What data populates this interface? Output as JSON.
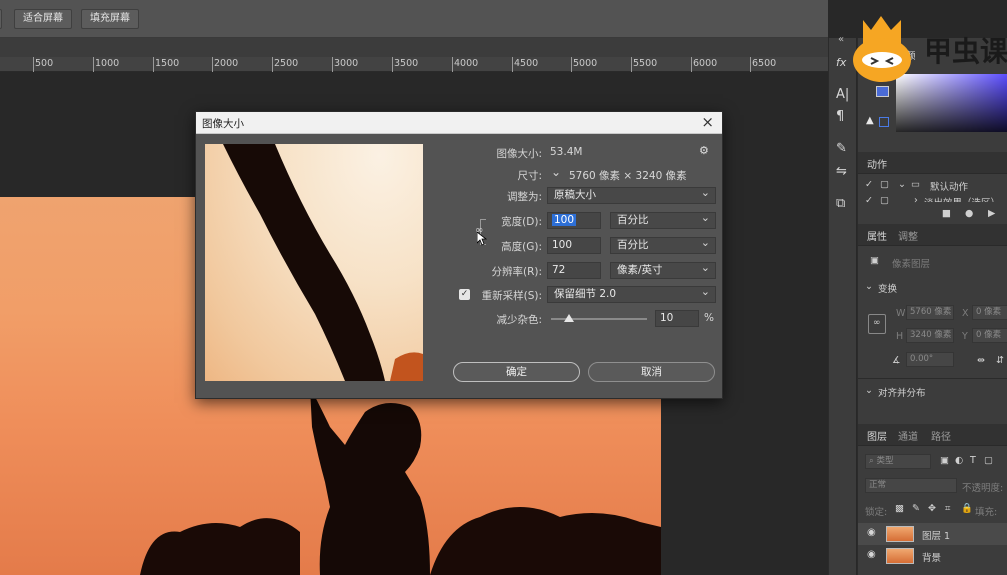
{
  "options_bar": {
    "fit_screen": "适合屏幕",
    "fill_screen": "填充屏幕"
  },
  "ruler": {
    "labels": [
      "500",
      "1000",
      "1500",
      "2000",
      "2500",
      "3000",
      "3500",
      "4000",
      "4500",
      "5000",
      "5500",
      "6000",
      "6500"
    ]
  },
  "dialog": {
    "title": "图像大小",
    "close_icon": "close-icon",
    "image_size_label": "图像大小:",
    "image_size_value": "53.4M",
    "settings_icon": "gear-icon",
    "dimensions_label": "尺寸:",
    "dimensions_value": "5760 像素  ×  3240 像素",
    "fit_to_label": "调整为:",
    "fit_to_value": "原稿大小",
    "width_label": "宽度(D):",
    "width_value": "100",
    "width_unit": "百分比",
    "height_label": "高度(G):",
    "height_value": "100",
    "height_unit": "百分比",
    "resolution_label": "分辨率(R):",
    "resolution_value": "72",
    "resolution_unit": "像素/英寸",
    "resample_label": "重新采样(S):",
    "resample_checked": true,
    "resample_value": "保留细节 2.0",
    "reduce_noise_label": "减少杂色:",
    "reduce_noise_value": "10",
    "reduce_noise_unit": "%",
    "reduce_noise_fraction": 0.1,
    "ok_label": "确定",
    "cancel_label": "取消"
  },
  "toolstrip": {
    "icons": [
      "fx-icon",
      "text-icon",
      "paragraph-icon",
      "brush-icon",
      "sliders-icon",
      "clone-source-icon"
    ]
  },
  "right_panel": {
    "collapse_label": "«",
    "brand_logo_text": "甲虫课堂",
    "color_tab": "颜",
    "actions_title": "动作",
    "actions_items": [
      "默认动作",
      "淡出效果（选区）"
    ],
    "properties_tab": "属性",
    "adjust_tab": "调整",
    "pixel_layer": "像素图层",
    "transform_label": "变换",
    "w_label": "W",
    "w_value": "5760 像素",
    "x_label": "X",
    "x_value": "0 像素",
    "h_label": "H",
    "h_value": "3240 像素",
    "y_label": "Y",
    "y_value": "0 像素",
    "angle_value": "0.00°",
    "align_label": "对齐并分布",
    "layers_tab": "图层",
    "channels_tab": "通道",
    "paths_tab": "路径",
    "kind_label": "类型",
    "blend_mode": "正常",
    "opacity_label": "不透明度:",
    "lock_label": "锁定:",
    "fill_label": "填充:",
    "layers": [
      "图层 1",
      "背景"
    ]
  }
}
